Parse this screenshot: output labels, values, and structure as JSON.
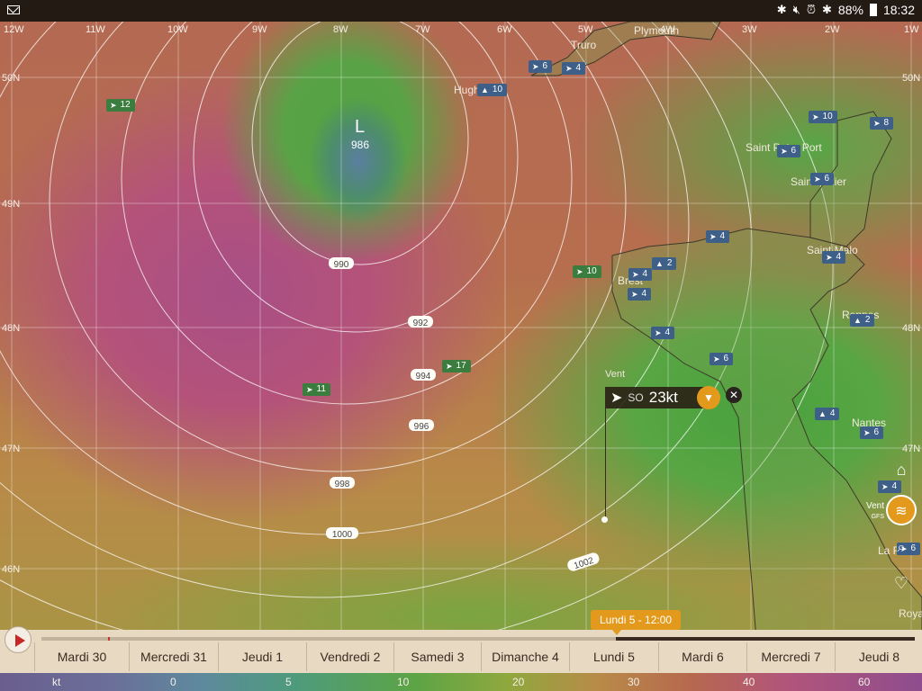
{
  "status_bar": {
    "battery": "88%",
    "time": "18:32"
  },
  "map": {
    "longitudes": [
      "12W",
      "11W",
      "10W",
      "9W",
      "8W",
      "7W",
      "6W",
      "5W",
      "4W",
      "3W",
      "2W",
      "1W"
    ],
    "latitudes": [
      "50N",
      "49N",
      "48N",
      "47N",
      "46N"
    ],
    "cities": [
      "Truro",
      "Plymouth",
      "Hugh",
      "Saint Peter Port",
      "Saint Helier",
      "Brest",
      "Saint Malo",
      "Rennes",
      "Nantes",
      "La Ro",
      "Roya"
    ],
    "low_pressure": {
      "letter": "L",
      "value": "986"
    },
    "isobars": [
      "990",
      "992",
      "994",
      "996",
      "998",
      "1000",
      "1002"
    ],
    "wind_markers": [
      {
        "v": "12",
        "color": "green",
        "dir": "➤"
      },
      {
        "v": "10",
        "color": "blue",
        "dir": "▲"
      },
      {
        "v": "6",
        "color": "blue",
        "dir": "➤"
      },
      {
        "v": "4",
        "color": "blue",
        "dir": "➤"
      },
      {
        "v": "10",
        "color": "blue",
        "dir": "➤"
      },
      {
        "v": "8",
        "color": "blue",
        "dir": "➤"
      },
      {
        "v": "6",
        "color": "blue",
        "dir": "➤"
      },
      {
        "v": "6",
        "color": "blue",
        "dir": "➤"
      },
      {
        "v": "4",
        "color": "blue",
        "dir": "➤"
      },
      {
        "v": "4",
        "color": "blue",
        "dir": "➤"
      },
      {
        "v": "10",
        "color": "green",
        "dir": "➤"
      },
      {
        "v": "4",
        "color": "blue",
        "dir": "➤"
      },
      {
        "v": "2",
        "color": "blue",
        "dir": "▲"
      },
      {
        "v": "4",
        "color": "blue",
        "dir": "➤"
      },
      {
        "v": "2",
        "color": "blue",
        "dir": "▲"
      },
      {
        "v": "4",
        "color": "blue",
        "dir": "➤"
      },
      {
        "v": "17",
        "color": "green",
        "dir": "➤"
      },
      {
        "v": "6",
        "color": "blue",
        "dir": "➤"
      },
      {
        "v": "11",
        "color": "green",
        "dir": "➤"
      },
      {
        "v": "4",
        "color": "blue",
        "dir": "▲"
      },
      {
        "v": "6",
        "color": "blue",
        "dir": "➤"
      },
      {
        "v": "4",
        "color": "blue",
        "dir": "➤"
      },
      {
        "v": "6",
        "color": "blue",
        "dir": "➤"
      }
    ]
  },
  "wind_popup": {
    "title": "Vent",
    "direction": "SO",
    "speed": "23kt"
  },
  "layer": {
    "label": "Vent",
    "model": "GFS"
  },
  "timeline": {
    "current": "Lundi 5 - 12:00",
    "progress": 0.658,
    "days": [
      "Mardi 30",
      "Mercredi 31",
      "Jeudi 1",
      "Vendredi 2",
      "Samedi 3",
      "Dimanche 4",
      "Lundi 5",
      "Mardi 6",
      "Mercredi 7",
      "Jeudi 8"
    ]
  },
  "scale": {
    "unit": "kt",
    "values": [
      "0",
      "5",
      "10",
      "20",
      "30",
      "40",
      "60"
    ]
  },
  "colors": {
    "accent": "#e39a1c",
    "marker_blue": "#3d5f88",
    "marker_green": "#3b7d3e"
  }
}
